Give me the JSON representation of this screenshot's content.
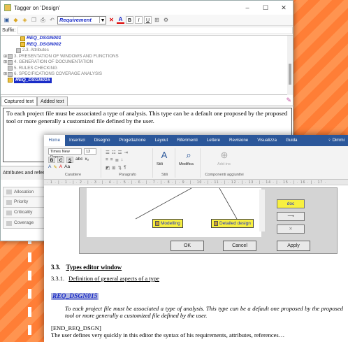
{
  "tagger": {
    "title": "Tagger on 'Design'",
    "controls": {
      "minimize": "–",
      "maximize": "☐",
      "close": "✕"
    },
    "toolbar": {
      "style_select": "Requirement",
      "icons": [
        "save-icon",
        "tag-icon",
        "tag-add-icon",
        "copy-icon",
        "print-icon",
        "undo-icon"
      ],
      "format": {
        "delete": "✕",
        "color": "A",
        "bold": "B",
        "italic": "I",
        "underline": "U"
      }
    },
    "suffix_label": "Suffix:",
    "tree": [
      {
        "label": "REQ_DSGN001",
        "kind": "req",
        "indent": 1
      },
      {
        "label": "REQ_DSGN002",
        "kind": "req",
        "indent": 1
      },
      {
        "label": "2.3. Attributes",
        "kind": "doc",
        "indent": 2
      },
      {
        "label": "3. PRESENTATION OF WINDOWS AND FUNCTIONS",
        "kind": "section",
        "indent": 0
      },
      {
        "label": "4. GENERATION OF DOCUMENTATION",
        "kind": "section",
        "indent": 0
      },
      {
        "label": "5. RULES CHECKING",
        "kind": "doc",
        "indent": 0
      },
      {
        "label": "6. SPECIFICATIONS COVERAGE ANALYSIS",
        "kind": "section",
        "indent": 0
      },
      {
        "label": "REQ_DSGN015",
        "kind": "req-selected",
        "indent": 0
      }
    ],
    "tabs": [
      "Captured text",
      "Added text"
    ],
    "captured_text": "To each project file must be associated a type of analysis. This type can be a default one proposed by the proposed tool or more generally a customized file defined by the user.",
    "attributes_header": "Attributes and referen",
    "attributes": [
      "Allocation",
      "Priority",
      "Criticality",
      "Coverage"
    ]
  },
  "word": {
    "ribbon_tabs": [
      "Home",
      "Inserisci",
      "Disegno",
      "Progettazione",
      "Layout",
      "Riferimenti",
      "Lettere",
      "Revisione",
      "Visualizza",
      "Guida"
    ],
    "help": "Dimmi",
    "font_name": "Times New Roman",
    "font_size": "12",
    "groups": {
      "font": "Carattere",
      "paragraph": "Paragrafo",
      "styles": "Stili",
      "editing": "Modifica",
      "addins": "Componenti aggiuntivi",
      "style_btn": "Stili",
      "addin_btn": "Add-ins"
    },
    "ruler": "· 1 · | · 1 · | · 2 · | · 3 · | · 4 · | · 5 · | · 6 · | · 7 · | · 8 · | · 9 · | · 10 · | · 11 · | · 12 · | · 13 · | · 14 · | · 15 · | · 16 · | · 17 ·",
    "figure": {
      "node_modelling": "Modelling",
      "node_detailed": "Detailed design",
      "doc_btn": "doc",
      "ok": "OK",
      "cancel": "Cancel",
      "apply": "Apply"
    },
    "heading_num": "3.3.",
    "heading_text": "Types editor window",
    "sub_num": "3.3.1.",
    "sub_text": "Definition of general aspects of a type",
    "req_tag": "REQ_DSGN015",
    "req_body": "To each project file must be associated a type of analysis. This type can be a default one proposed by the proposed tool or more generally a customized file defined by the user.",
    "end_tag": "[END_REQ_DSGN]",
    "last_line": "The user defines very quickly in this editor the syntax of his requirements, attributes, references…"
  }
}
